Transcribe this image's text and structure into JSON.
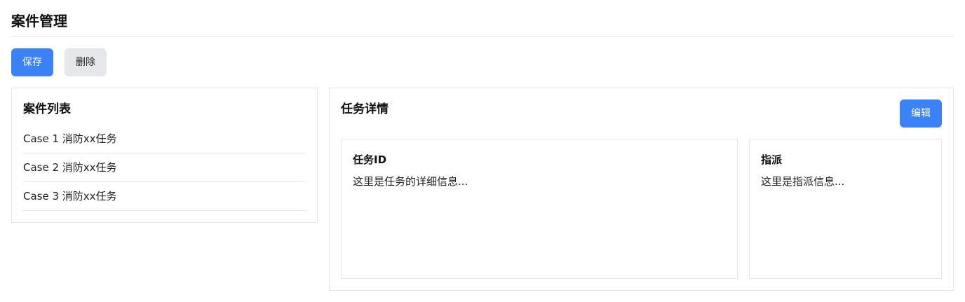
{
  "page": {
    "title": "案件管理"
  },
  "toolbar": {
    "save_label": "保存",
    "delete_label": "删除"
  },
  "case_list": {
    "title": "案件列表",
    "items": [
      {
        "label": "Case 1 消防xx任务"
      },
      {
        "label": "Case 2 消防xx任务"
      },
      {
        "label": "Case 3 消防xx任务"
      }
    ]
  },
  "task_detail": {
    "title": "任务详情",
    "edit_label": "编辑",
    "task_card": {
      "title": "任务ID",
      "text": "这里是任务的详细信息..."
    },
    "assign_card": {
      "title": "指派",
      "text": "这里是指派信息..."
    }
  },
  "colors": {
    "primary": "#3b82f6",
    "secondary_bg": "#e5e7eb",
    "border": "#e5e5e5",
    "text": "#111111"
  }
}
